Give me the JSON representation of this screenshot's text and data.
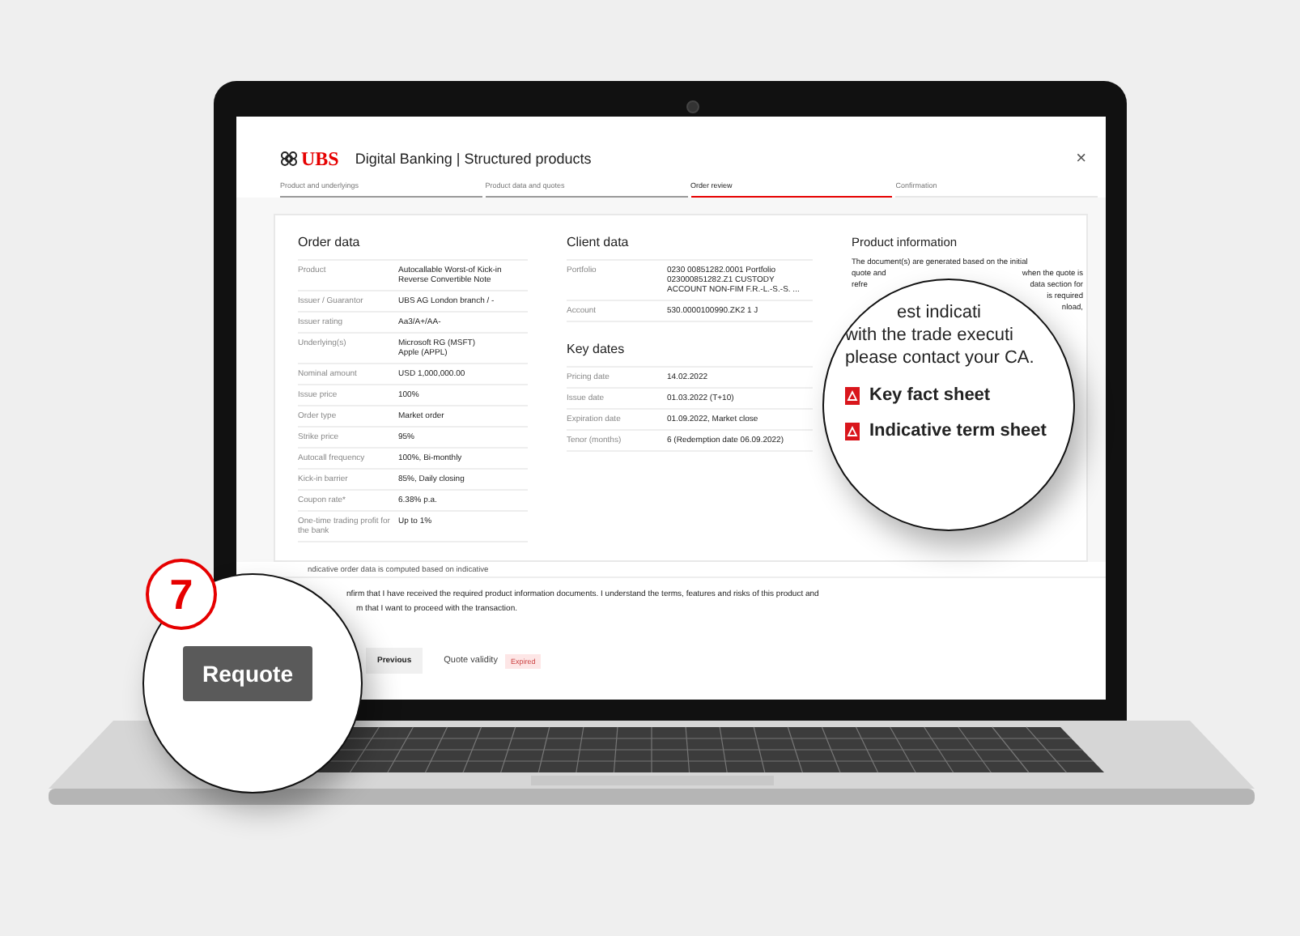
{
  "header": {
    "brand": "UBS",
    "title": "Digital Banking | Structured products",
    "close": "×"
  },
  "steps": [
    {
      "label": "Product and underlyings",
      "completed": true,
      "selected": false
    },
    {
      "label": "Product data and quotes",
      "completed": true,
      "selected": false
    },
    {
      "label": "Order review",
      "completed": false,
      "selected": true
    },
    {
      "label": "Confirmation",
      "completed": false,
      "selected": false
    }
  ],
  "order_data": {
    "title": "Order data",
    "rows": [
      {
        "label": "Product",
        "value": "Autocallable Worst-of Kick-in Reverse Convertible Note"
      },
      {
        "label": "Issuer / Guarantor",
        "value": "UBS AG London branch / -"
      },
      {
        "label": "Issuer rating",
        "value": "Aa3/A+/AA-"
      },
      {
        "label": "Underlying(s)",
        "value": "Microsoft RG (MSFT)\nApple (APPL)"
      },
      {
        "label": "Nominal amount",
        "value": "USD 1,000,000.00"
      },
      {
        "label": "Issue price",
        "value": "100%"
      },
      {
        "label": "Order type",
        "value": "Market order"
      },
      {
        "label": "Strike price",
        "value": "95%"
      },
      {
        "label": "Autocall frequency",
        "value": "100%, Bi-monthly"
      },
      {
        "label": "Kick-in barrier",
        "value": "85%, Daily closing"
      },
      {
        "label": "Coupon rate*",
        "value": "6.38% p.a."
      },
      {
        "label": "One-time trading profit for the bank",
        "value": "Up to 1%"
      }
    ]
  },
  "client_data": {
    "title": "Client data",
    "rows": [
      {
        "label": "Portfolio",
        "value": "0230 00851282.0001 Portfolio 023000851282.Z1 CUSTODY ACCOUNT NON-FIM F.R.-L.-S.-S. ..."
      },
      {
        "label": "Account",
        "value": "530.0000100990.ZK2 1 J"
      }
    ]
  },
  "key_dates": {
    "title": "Key dates",
    "rows": [
      {
        "label": "Pricing date",
        "value": "14.02.2022"
      },
      {
        "label": "Issue date",
        "value": "01.03.2022 (T+10)"
      },
      {
        "label": "Expiration date",
        "value": "01.09.2022, Market close"
      },
      {
        "label": "Tenor (months)",
        "value": "6 (Redemption date 06.09.2022)"
      }
    ]
  },
  "product_information": {
    "title": "Product information",
    "lines": [
      {
        "left": "The document(s) are generated based on the initial"
      },
      {
        "left": "quote and",
        "right": "when the quote is"
      },
      {
        "left": "refre",
        "right": "data section for"
      },
      {
        "right": "is required"
      },
      {
        "right": "nload,"
      }
    ]
  },
  "footnote": "ndicative order data is computed based on indicative",
  "confirmation_lines": [
    "nfirm that I have received the required product information documents. I understand the terms, features and risks of this product and",
    "m that I want to proceed with the transaction."
  ],
  "previous_button": "Previous",
  "quote_validity": {
    "label": "Quote validity",
    "badge": "Expired"
  },
  "magnifier_documents": {
    "lines": [
      "est indicati",
      "with the trade executi",
      "please contact your CA."
    ],
    "documents": [
      "Key fact sheet",
      "Indicative term sheet"
    ]
  },
  "magnifier_button": {
    "label": "Requote"
  },
  "step_badge": "7"
}
